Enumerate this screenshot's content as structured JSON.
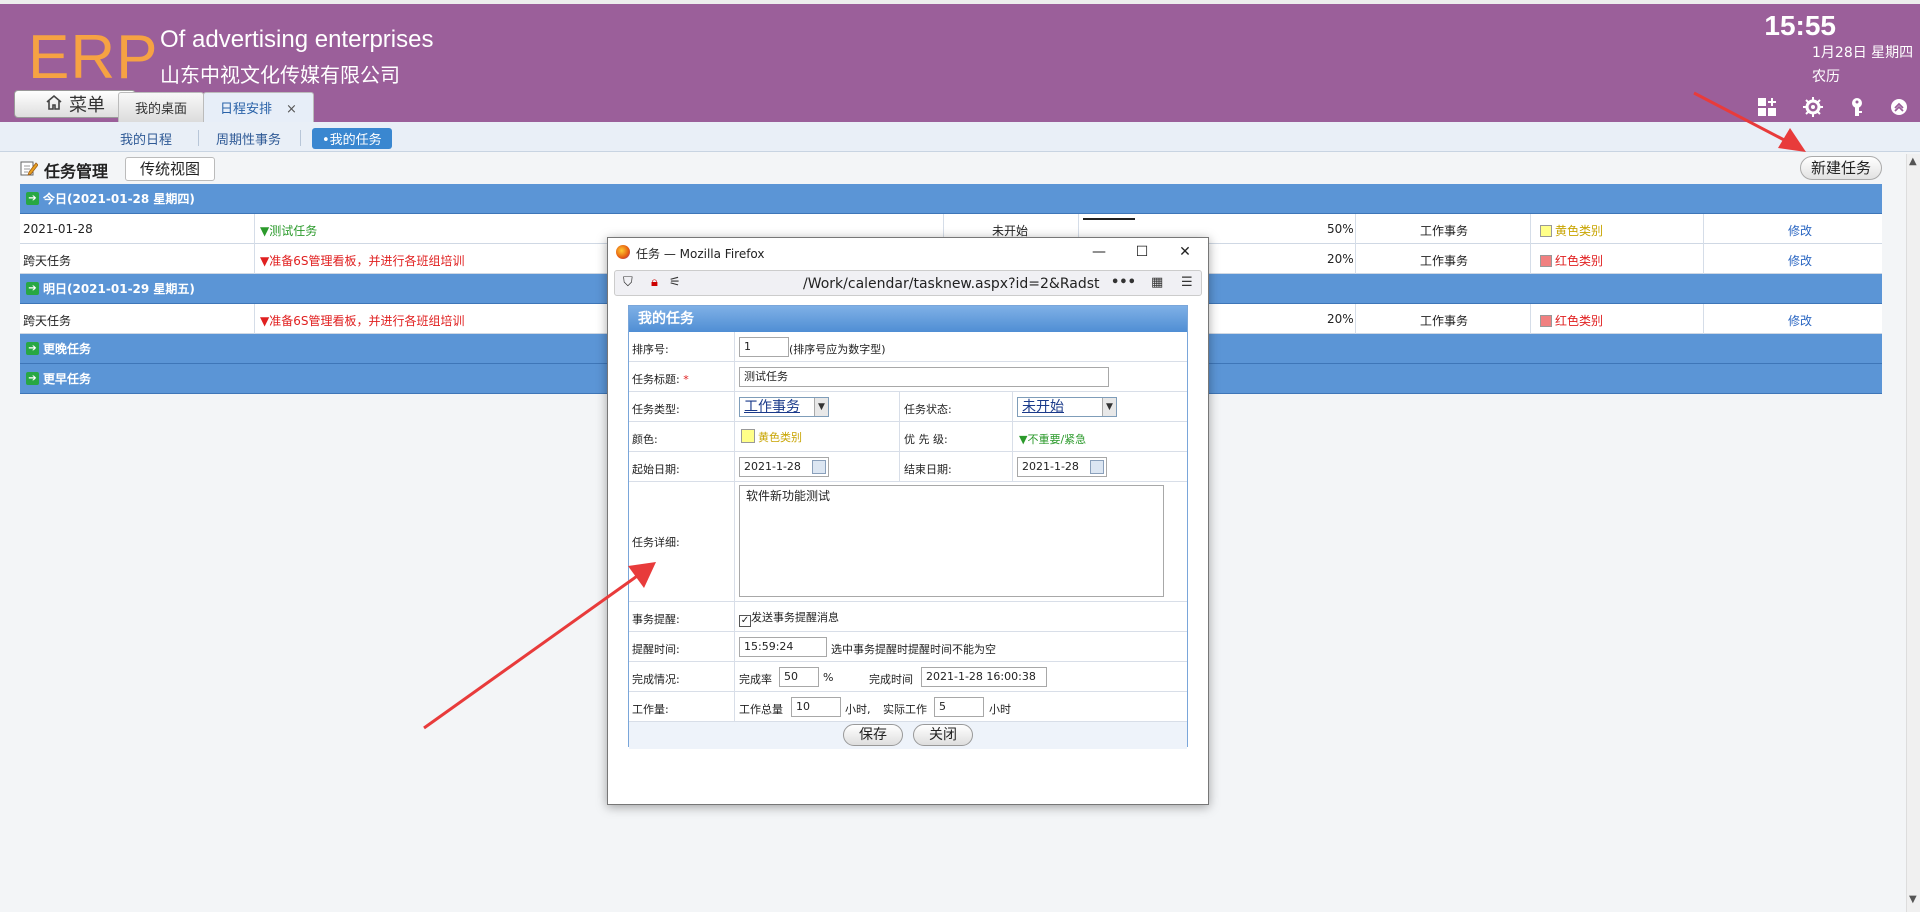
{
  "header": {
    "logo": "ERP",
    "company_en": "Of advertising enterprises",
    "company_cn": "山东中视文化传媒有限公司",
    "clock": "15:55",
    "date": "1月28日 星期四",
    "lunar": "农历",
    "menu_label": "菜单",
    "tabs": [
      {
        "label": "我的桌面"
      },
      {
        "label": "日程安排",
        "close": "×"
      }
    ]
  },
  "subnav": [
    "我的日程",
    "周期性事务",
    "•我的任务"
  ],
  "page": {
    "title": "任务管理",
    "view_button": "传统视图",
    "new_task_button": "新建任务"
  },
  "groups": {
    "today": "今日(2021-01-28 星期四)",
    "tomorrow": "明日(2021-01-29 星期五)",
    "later": "更晚任务",
    "earlier": "更早任务"
  },
  "rows": [
    {
      "date": "2021-01-28",
      "title": "测试任务",
      "status": "未开始",
      "progress": "50%",
      "type": "工作事务",
      "color_label": "黄色类别",
      "action": "修改"
    },
    {
      "date": "跨天任务",
      "title": "准备6S管理看板，并进行各班组培训",
      "progress": "20%",
      "type": "工作事务",
      "color_label": "红色类别",
      "action": "修改"
    },
    {
      "date": "跨天任务",
      "title": "准备6S管理看板，并进行各班组培训",
      "progress": "20%",
      "type": "工作事务",
      "color_label": "红色类别",
      "action": "修改"
    }
  ],
  "popup": {
    "window_title": "任务 — Mozilla Firefox",
    "url": "/Work/calendar/tasknew.aspx?id=2&Radst",
    "form_title": "我的任务",
    "labels": {
      "order": "排序号:",
      "order_hint": "(排序号应为数字型)",
      "title": "任务标题:",
      "required": "*",
      "type": "任务类型:",
      "status": "任务状态:",
      "color": "颜色:",
      "priority": "优 先 级:",
      "start": "起始日期:",
      "end": "结束日期:",
      "detail": "任务详细:",
      "reminder": "事务提醒:",
      "reminder_check": "发送事务提醒消息",
      "remind_time": "提醒时间:",
      "remind_hint": "选中事务提醒时提醒时间不能为空",
      "completion": "完成情况:",
      "rate": "完成率",
      "percent": "%",
      "done_time": "完成时间",
      "workload": "工作量:",
      "total": "工作总量",
      "hours": "小时,",
      "actual": "实际工作",
      "hours2": "小时"
    },
    "values": {
      "order": "1",
      "title": "测试任务",
      "type": "工作事务",
      "status": "未开始",
      "color": "黄色类别",
      "priority": "不重要/紧急",
      "start": "2021-1-28",
      "end": "2021-1-28",
      "detail": "软件新功能测试",
      "remind_time": "15:59:24",
      "rate": "50",
      "done_time": "2021-1-28 16:00:38",
      "total": "10",
      "actual": "5"
    },
    "buttons": {
      "save": "保存",
      "close": "关闭"
    }
  },
  "colors": {
    "header_bg": "#9b5f9a",
    "logo": "#f6a243",
    "group_bar": "#5b95d6",
    "annotation_arrow": "#e83b3b"
  }
}
